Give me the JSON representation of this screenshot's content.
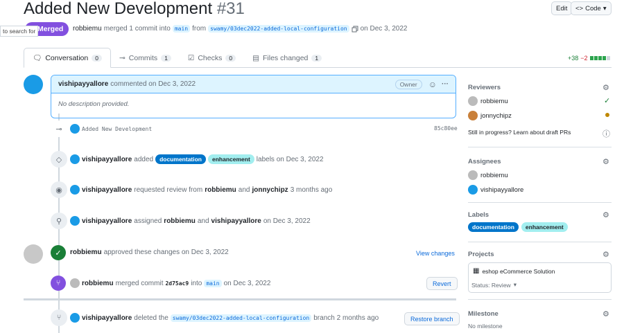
{
  "pr": {
    "title": "Added New Development",
    "number": "#31",
    "state": "Merged",
    "author": "robbiemu",
    "merge_text": "merged 1 commit into",
    "base_branch": "main",
    "from_text": "from",
    "head_branch": "swamy/03dec2022-added-local-configuration",
    "merged_date": "on Dec 3, 2022"
  },
  "header": {
    "edit_label": "Edit",
    "code_label": "Code"
  },
  "tooltip": {
    "text": "to search for"
  },
  "tabs": [
    {
      "label": "Conversation",
      "count": "0"
    },
    {
      "label": "Commits",
      "count": "1"
    },
    {
      "label": "Checks",
      "count": "0"
    },
    {
      "label": "Files changed",
      "count": "1"
    }
  ],
  "diffstat": {
    "additions": "+38",
    "deletions": "−2"
  },
  "comment": {
    "author": "vishipayyallore",
    "action": "commented on Dec 3, 2022",
    "role": "Owner",
    "body": "No description provided."
  },
  "timeline": {
    "commit": {
      "message": "Added New Development",
      "sha": "85c80ee"
    },
    "labels_event": {
      "actor": "vishipayyallore",
      "pre": "added",
      "labels": [
        "documentation",
        "enhancement"
      ],
      "post": "labels on Dec 3, 2022"
    },
    "review_req": {
      "actor": "vishipayyallore",
      "pre": "requested review from",
      "user1": "robbiemu",
      "and": "and",
      "user2": "jonnychipz",
      "post": "3 months ago"
    },
    "assign": {
      "actor": "vishipayyallore",
      "pre": "assigned",
      "user1": "robbiemu",
      "and": "and",
      "user2": "vishipayyallore",
      "post": "on Dec 3, 2022"
    },
    "approve": {
      "actor": "robbiemu",
      "text": "approved these changes on Dec 3, 2022",
      "button": "View changes"
    },
    "merge": {
      "actor": "robbiemu",
      "pre": "merged commit",
      "sha": "2d75ac9",
      "into": "into",
      "branch": "main",
      "post": "on Dec 3, 2022",
      "button": "Revert"
    },
    "delete": {
      "actor": "vishipayyallore",
      "pre": "deleted the",
      "branch": "swamy/03dec2022-added-local-configuration",
      "post": "branch 2 months ago",
      "button": "Restore branch"
    }
  },
  "sidebar": {
    "reviewers": {
      "title": "Reviewers",
      "items": [
        "robbiemu",
        "jonnychipz"
      ],
      "draft_text": "Still in progress? Learn about draft PRs"
    },
    "assignees": {
      "title": "Assignees",
      "items": [
        "robbiemu",
        "vishipayyallore"
      ]
    },
    "labels": {
      "title": "Labels",
      "items": [
        "documentation",
        "enhancement"
      ]
    },
    "projects": {
      "title": "Projects",
      "name": "eshop eCommerce Solution",
      "status": "Status: Review"
    },
    "milestone": {
      "title": "Milestone",
      "value": "No milestone"
    }
  },
  "colors": {
    "merged": "#8250df",
    "link": "#0969da",
    "approve": "#1a7f37",
    "label_doc": "#0075ca",
    "label_enh": "#a2eeef"
  }
}
